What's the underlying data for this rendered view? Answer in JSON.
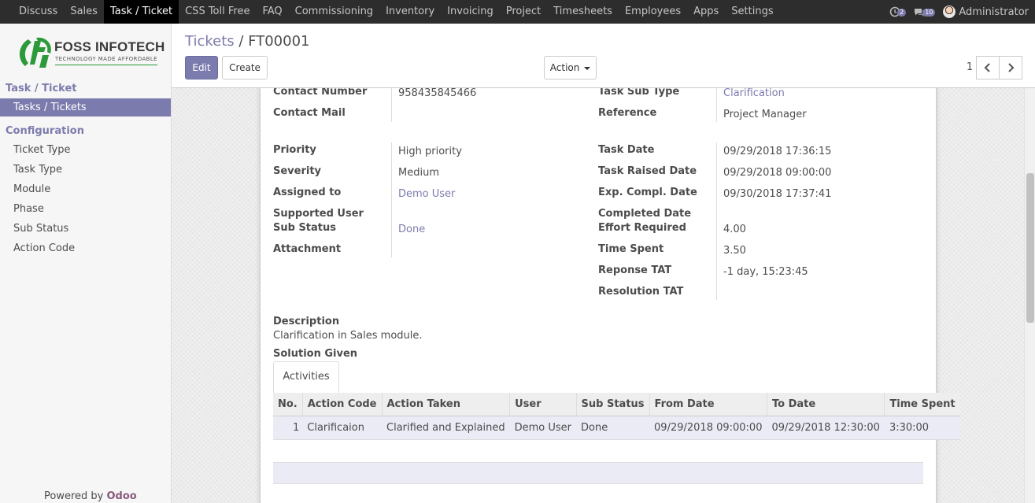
{
  "topbar": {
    "menu": [
      "Discuss",
      "Sales",
      "Task / Ticket",
      "CSS Toll Free",
      "FAQ",
      "Commissioning",
      "Inventory",
      "Invoicing",
      "Project",
      "Timesheets",
      "Employees",
      "Apps",
      "Settings"
    ],
    "active_menu": "Task / Ticket",
    "activity_count": "2",
    "message_count": "10",
    "user_name": "Administrator",
    "icons": [
      "clock-icon",
      "chat-icon",
      "avatar"
    ]
  },
  "sidebar": {
    "logo_brand": "FOSS INFOTECH",
    "logo_tagline": "TECHNOLOGY MADE AFFORDABLE",
    "section_task": "Task / Ticket",
    "item_tasks": "Tasks / Tickets",
    "section_config": "Configuration",
    "config_items": [
      "Ticket Type",
      "Task Type",
      "Module",
      "Phase",
      "Sub Status",
      "Action Code"
    ],
    "powered_by": "Powered by",
    "powered_brand": "Odoo"
  },
  "control": {
    "breadcrumb_parent": "Tickets",
    "breadcrumb_sep": "/",
    "breadcrumb_current": "FT00001",
    "edit_label": "Edit",
    "create_label": "Create",
    "action_label": "Action",
    "pager": "1 / 1"
  },
  "form": {
    "left_top": [
      {
        "label": "Contact Number",
        "value": "958435845466"
      },
      {
        "label": "Contact Mail",
        "value": ""
      }
    ],
    "right_top": [
      {
        "label": "Task Sub Type",
        "value": "Clarification"
      },
      {
        "label": "Reference",
        "value": "Project Manager"
      }
    ],
    "left_main": [
      {
        "label": "Priority",
        "value": "High priority"
      },
      {
        "label": "Severity",
        "value": "Medium"
      },
      {
        "label": "Assigned to",
        "value": "Demo User"
      },
      {
        "label": "Supported User",
        "value": ""
      },
      {
        "label": "Sub Status",
        "value": "Done"
      },
      {
        "label": "Attachment",
        "value": ""
      }
    ],
    "right_main": [
      {
        "label": "Task Date",
        "value": "09/29/2018 17:36:15"
      },
      {
        "label": "Task Raised Date",
        "value": "09/29/2018 09:00:00"
      },
      {
        "label": "Exp. Compl. Date",
        "value": "09/30/2018 17:37:41"
      },
      {
        "label": "Completed Date",
        "value": ""
      },
      {
        "label": "Effort Required",
        "value": "4.00"
      },
      {
        "label": "Time Spent",
        "value": "3.50"
      },
      {
        "label": "Reponse TAT",
        "value": "-1 day, 15:23:45"
      },
      {
        "label": "Resolution TAT",
        "value": ""
      }
    ],
    "description_label": "Description",
    "description_text": "Clarification in Sales module.",
    "solution_label": "Solution Given"
  },
  "activities": {
    "tab_label": "Activities",
    "columns": [
      "No.",
      "Action Code",
      "Action Taken",
      "User",
      "Sub Status",
      "From Date",
      "To Date",
      "Time Spent"
    ],
    "rows": [
      [
        "1",
        "Clarificaion",
        "Clarified and Explained",
        "Demo User",
        "Done",
        "09/29/2018 09:00:00",
        "09/29/2018 12:30:00",
        "3:30:00"
      ]
    ]
  }
}
